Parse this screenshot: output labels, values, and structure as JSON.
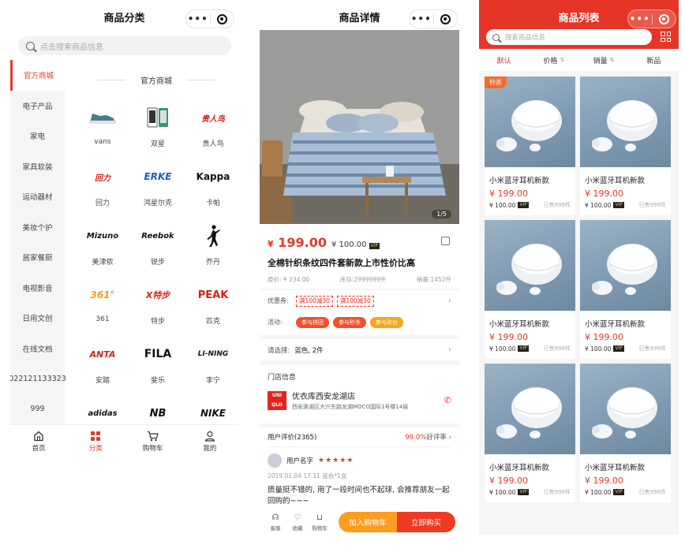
{
  "category": {
    "title": "商品分类",
    "search_placeholder": "点击搜索商品信息",
    "sidebar": [
      "官方商城",
      "电子产品",
      "家电",
      "家具软装",
      "运动器材",
      "美妆个护",
      "居家餐厨",
      "电视影音",
      "日用文创",
      "在线文档",
      "022121133323",
      "999"
    ],
    "section_title": "官方商城",
    "brands": [
      {
        "name": "vans",
        "logo": ""
      },
      {
        "name": "双星",
        "logo": ""
      },
      {
        "name": "贵人鸟",
        "logo": "贵人鸟"
      },
      {
        "name": "回力",
        "logo": "回力"
      },
      {
        "name": "鸿星尔克",
        "logo": "ERKE"
      },
      {
        "name": "卡帕",
        "logo": "Kappa"
      },
      {
        "name": "美津侬",
        "logo": "Mizuno"
      },
      {
        "name": "锐步",
        "logo": "Reebok"
      },
      {
        "name": "乔丹",
        "logo": ""
      },
      {
        "name": "361",
        "logo": "361°"
      },
      {
        "name": "特步",
        "logo": "X特步"
      },
      {
        "name": "匹克",
        "logo": "PEAK"
      },
      {
        "name": "安踏",
        "logo": "ANTA"
      },
      {
        "name": "斐乐",
        "logo": "FILA"
      },
      {
        "name": "李宁",
        "logo": "LI-NING"
      },
      {
        "name": "",
        "logo": "adidas"
      },
      {
        "name": "",
        "logo": "NB"
      },
      {
        "name": "",
        "logo": "NIKE"
      }
    ],
    "tabs": [
      {
        "label": "首页",
        "icon": "home-icon"
      },
      {
        "label": "分类",
        "icon": "category-icon"
      },
      {
        "label": "购物车",
        "icon": "cart-icon"
      },
      {
        "label": "我的",
        "icon": "user-icon"
      }
    ]
  },
  "detail": {
    "title": "商品详情",
    "image_counter": "1/5",
    "price_symbol": "¥",
    "price": "199.00",
    "vip_price": "¥ 100.00",
    "vip_label": "VIP",
    "product_title": "全棉针织条纹四件套新款上市性价比高",
    "original_price": "原价: ¥ 234.00",
    "stock": "库存:2999999件",
    "sales": "销量:1452件",
    "coupon_label": "优惠券:",
    "coupons": [
      "满100减30",
      "满100减30"
    ],
    "activity_label": "活动:",
    "activities": [
      {
        "label": "参与拼团",
        "color": "#f2512e"
      },
      {
        "label": "参与秒杀",
        "color": "#f2512e"
      },
      {
        "label": "参与砍价",
        "color": "#f6a61d"
      }
    ],
    "select_label": "请选择:",
    "select_value": "蓝色, 2件",
    "store_header": "门店信息",
    "store_logo": [
      "UNI",
      "QLO"
    ],
    "store_name": "优衣库西安龙湖店",
    "store_address": "西安莲湖区大兴东路龙湖MOCO国际1号楼14层",
    "review_header": "用户评价(2365)",
    "good_rate": "99.0%",
    "good_rate_label": "好评率",
    "reviewer_name": "用户名字",
    "stars": "★★★★★",
    "review_meta": "2019.01.04 17:11 蓝色*1盒",
    "review_text": "质量挺不错的, 用了一段时间也不起球, 会推荐朋友一起回购的~~~",
    "bottom_icons": [
      {
        "label": "客服",
        "icon": "headset-icon"
      },
      {
        "label": "收藏",
        "icon": "heart-icon"
      },
      {
        "label": "购物车",
        "icon": "cart-icon"
      }
    ],
    "add_cart": "加入购物车",
    "buy_now": "立即购买"
  },
  "list": {
    "title": "商品列表",
    "search_placeholder": "搜索商品信息",
    "sorts": [
      "默认",
      "价格",
      "销量",
      "新品"
    ],
    "badge": "秒杀",
    "products": [
      {
        "name": "小米蓝牙耳机新款",
        "price": "¥ 199.00",
        "vip_price": "¥ 100.00",
        "sold": "已售999件",
        "badge": true
      },
      {
        "name": "小米蓝牙耳机新款",
        "price": "¥ 199.00",
        "vip_price": "¥ 100.00",
        "sold": "已售999件",
        "badge": false
      },
      {
        "name": "小米蓝牙耳机新款",
        "price": "¥ 199.00",
        "vip_price": "¥ 100.00",
        "sold": "已售999件",
        "badge": false
      },
      {
        "name": "小米蓝牙耳机新款",
        "price": "¥ 199.00",
        "vip_price": "¥ 100.00",
        "sold": "已售999件",
        "badge": false
      },
      {
        "name": "小米蓝牙耳机新款",
        "price": "¥ 199.00",
        "vip_price": "¥ 100.00",
        "sold": "已售999件",
        "badge": false
      },
      {
        "name": "小米蓝牙耳机新款",
        "price": "¥ 199.00",
        "vip_price": "¥ 100.00",
        "sold": "已售999件",
        "badge": false
      }
    ]
  },
  "colors": {
    "accent": "#e4392b",
    "header_red": "#e63526",
    "cart_orange": "#ff9d21",
    "buy_red": "#ee3a22"
  }
}
